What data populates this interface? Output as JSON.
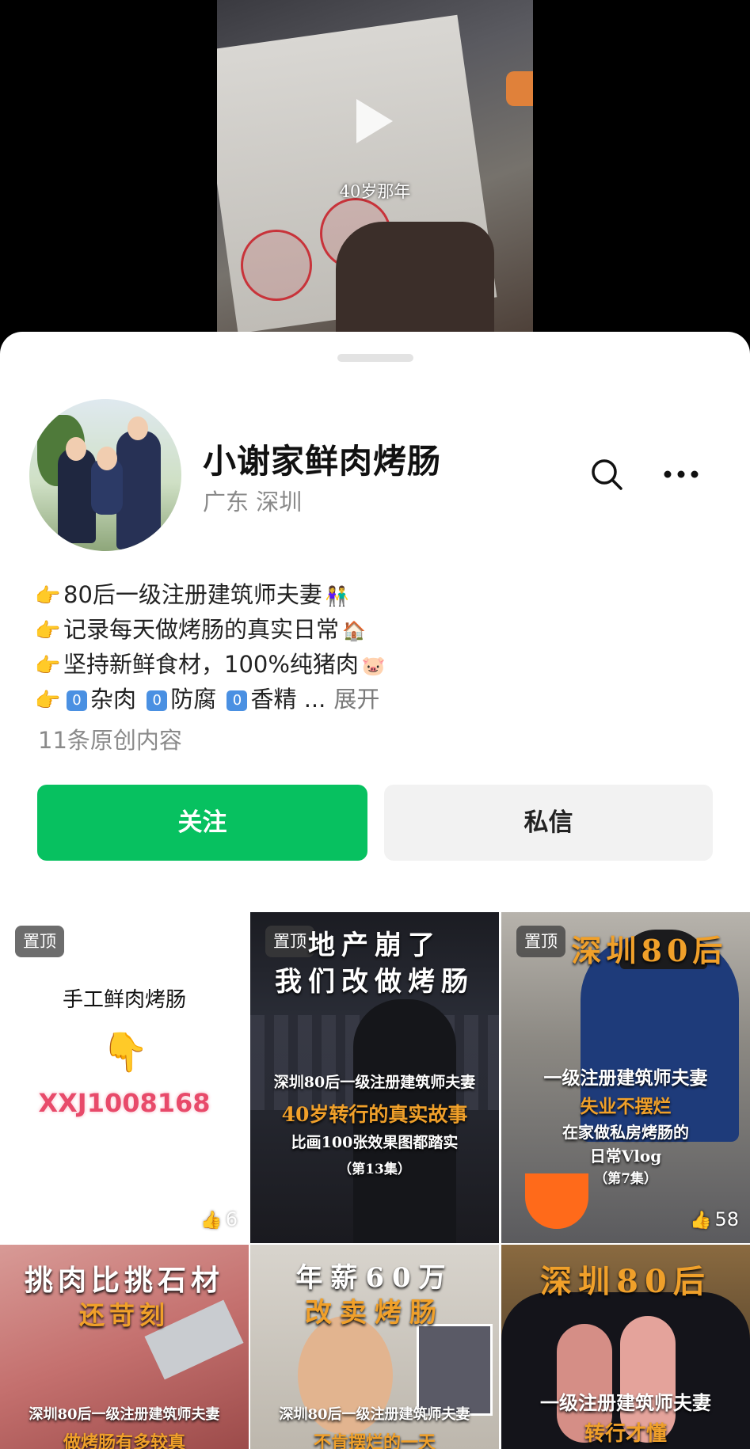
{
  "video": {
    "caption": "40岁那年"
  },
  "profile": {
    "name": "小谢家鲜肉烤肠",
    "location": "广东 深圳",
    "bio": [
      {
        "text": "80后一级注册建筑师夫妻",
        "emoji": "👫"
      },
      {
        "text": "记录每天做烤肠的真实日常",
        "emoji": "🏠"
      },
      {
        "text": "坚持新鲜食材，100%纯猪肉",
        "emoji": "🐷"
      }
    ],
    "bio_last": {
      "items": [
        "杂肉",
        "防腐",
        "香精"
      ],
      "zero": "0",
      "ellipsis": "...",
      "expand": "展开"
    },
    "original_count": "11条原创内容"
  },
  "actions": {
    "follow": "关注",
    "message": "私信"
  },
  "pin_label": "置顶",
  "posts": [
    {
      "pinned": true,
      "lines": [
        "手工鲜肉烤肠",
        "XXJ1008168"
      ],
      "likes": "6"
    },
    {
      "pinned": true,
      "lines": [
        "地产崩了",
        "我们改做烤肠",
        "深圳80后一级注册建筑师夫妻",
        "40岁转行的真实故事",
        "比画100张效果图都踏实",
        "（第13集）"
      ],
      "likes": ""
    },
    {
      "pinned": true,
      "lines": [
        "深圳80后",
        "一级注册建筑师夫妻",
        "失业不摆烂",
        "在家做私房烤肠的",
        "日常Vlog",
        "（第7集）"
      ],
      "likes": "58"
    },
    {
      "pinned": false,
      "lines": [
        "挑肉比挑石材",
        "还苛刻",
        "深圳80后一级注册建筑师夫妻",
        "做烤肠有多较真"
      ],
      "likes": ""
    },
    {
      "pinned": false,
      "lines": [
        "年薪60万",
        "改卖烤肠",
        "深圳80后一级注册建筑师夫妻",
        "不肯摆烂的一天"
      ],
      "likes": ""
    },
    {
      "pinned": false,
      "lines": [
        "深圳80后",
        "一级注册建筑师夫妻",
        "转行才懂"
      ],
      "likes": ""
    }
  ],
  "colors": {
    "follow": "#07c160",
    "message_bg": "#f2f2f2",
    "pink_code": "#e84a6a",
    "orange_title": "#f0a02a"
  }
}
